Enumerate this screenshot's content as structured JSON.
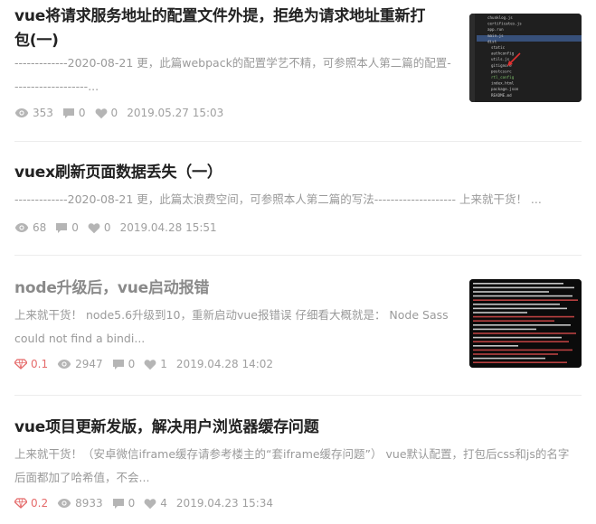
{
  "articles": [
    {
      "title": "vue将请求服务地址的配置文件外提，拒绝为请求地址重新打包(一)",
      "title_line1": "vue将请求服务地址的配置文件外提，拒绝为请求地址重新打",
      "title_line2": "包(一)",
      "desc_line1": "-------------2020-08-21 更，此篇webpack的配置学艺不精，可参照本人第二篇的配置-",
      "desc_line2": "------------------...",
      "views": "353",
      "comments": "0",
      "likes": "0",
      "date": "2019.05.27 15:03",
      "thumbnail": "vscode-file-tree-screenshot",
      "thumb_files": [
        "chunklog.js",
        "certificates.js",
        "app.run",
        "main.js",
        "dist",
        "static",
        "authconfig",
        "utils.js",
        "gitignore",
        "postcssrc",
        "rtl_config",
        "index.html",
        "package.json",
        "README.md"
      ]
    },
    {
      "title": "vuex刷新页面数据丢失（一）",
      "desc_line1": "-------------2020-08-21 更，此篇太浪费空间，可参照本人第二篇的写法-------------------- 上来就干货！ ...",
      "views": "68",
      "comments": "0",
      "likes": "0",
      "date": "2019.04.28 15:51"
    },
    {
      "title": "node升级后，vue启动报错",
      "desc_line1": "上来就干货！ node5.6升级到10，重新启动vue报错误 仔细看大概就是： Node Sass",
      "desc_line2": "could not find a bindi...",
      "gem": "0.1",
      "views": "2947",
      "comments": "0",
      "likes": "1",
      "date": "2019.04.28 14:02",
      "thumbnail": "terminal-error-screenshot"
    },
    {
      "title": "vue项目更新发版，解决用户浏览器缓存问题",
      "desc_line1": "上来就干货！（安卓微信iframe缓存请参考楼主的“套iframe缓存问题”） vue默认配置，打包后css和js的名字",
      "desc_line2": "后面都加了哈希值，不会...",
      "gem": "0.2",
      "views": "8933",
      "comments": "0",
      "likes": "4",
      "date": "2019.04.23 15:34"
    }
  ],
  "colors": {
    "title": "#222222",
    "title_visited": "#8a8a8a",
    "text_muted": "#9a9a9a",
    "gem_red": "#e56b6b"
  }
}
